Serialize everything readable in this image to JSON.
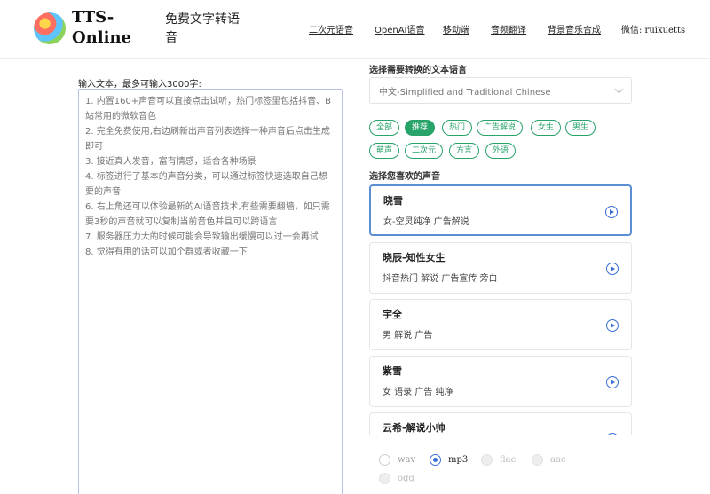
{
  "header": {
    "brand": "TTS-Online",
    "slogan": "免费文字转语音",
    "nav": [
      "二次元语音",
      "OpenAI语音",
      "移动端",
      "音频翻译",
      "背景音乐合成"
    ],
    "wechat": "微信: ruixuetts"
  },
  "input": {
    "label": "输入文本，最多可输入3000字:",
    "placeholder": "1. 内置160+声音可以直接点击试听，热门标签里包括抖音、B站常用的微软音色\n2. 完全免费使用,右边刷新出声音列表选择一种声音后点击生成即可\n3. 接近真人发音，富有情感，适合各种场景\n4. 标签进行了基本的声音分类，可以通过标签快速选取自己想要的声音\n6. 右上角还可以体验最新的AI语音技术,有些需要翻墙，如只需要3秒的声音就可以复制当前音色并且可以跨语言\n7. 服务器压力大的时候可能会导致输出缓慢可以过一会再试\n8. 觉得有用的话可以加个群或者收藏一下"
  },
  "language": {
    "label": "选择需要转换的文本语言",
    "selected": "中文-Simplified and Traditional Chinese"
  },
  "tags": {
    "row1": [
      "全部",
      "推荐",
      "热门",
      "广告解说",
      "女生",
      "男生"
    ],
    "row2": [
      "萌声",
      "二次元",
      "方言",
      "外语"
    ],
    "active": "推荐"
  },
  "voices": {
    "label": "选择您喜欢的声音",
    "items": [
      {
        "name": "晓雪",
        "desc": "女-空灵纯净 广告解说"
      },
      {
        "name": "晓辰-知性女生",
        "desc": "抖音热门 解说 广告宣传 旁白"
      },
      {
        "name": "宇全",
        "desc": "男 解说 广告"
      },
      {
        "name": "紫雪",
        "desc": "女 语录 广告 纯净"
      },
      {
        "name": "云希-解说小帅",
        "desc": ""
      }
    ]
  },
  "formats": {
    "options": [
      "wav",
      "mp3",
      "flac",
      "aac",
      "ogg"
    ],
    "selected": "mp3"
  },
  "colors": {
    "accent_green": "#27a36a",
    "accent_blue": "#3a6fd8",
    "selected_border": "#5b8fd1"
  }
}
